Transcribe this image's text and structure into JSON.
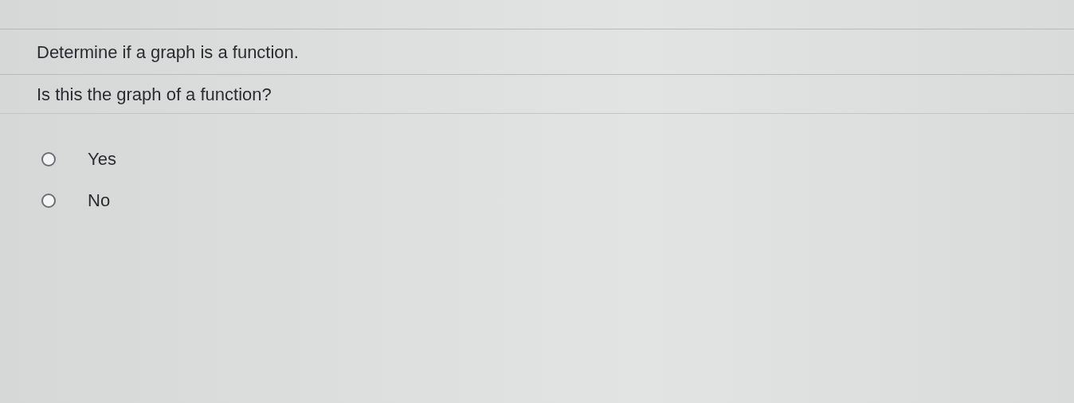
{
  "header": {
    "title": "Determine if a graph is a function."
  },
  "question": {
    "prompt": "Is this the graph of a function?",
    "options": [
      {
        "label": "Yes",
        "selected": false
      },
      {
        "label": "No",
        "selected": false
      }
    ]
  }
}
